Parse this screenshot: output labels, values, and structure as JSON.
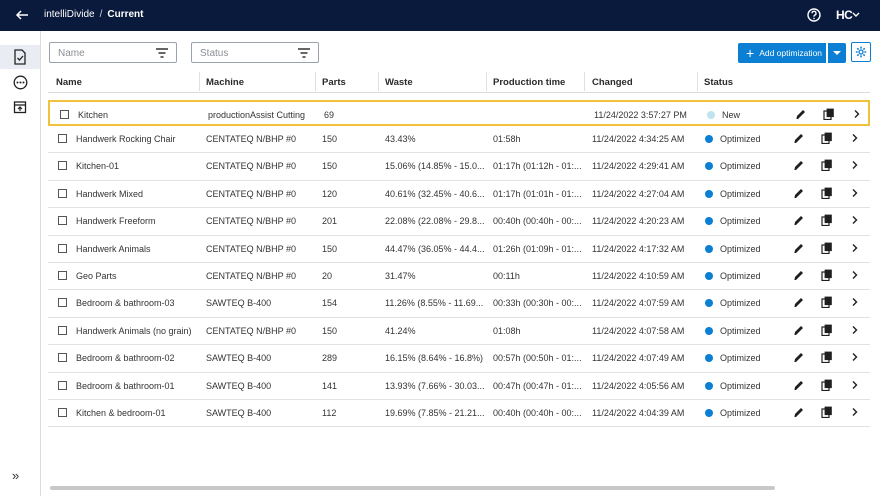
{
  "header": {
    "app": "intelliDivide",
    "separator": "/",
    "current": "Current",
    "logo_text": "HC"
  },
  "sidebar": {
    "items": [
      {
        "icon": "document-check-icon",
        "active": true
      },
      {
        "icon": "more-circle-icon",
        "active": false
      },
      {
        "icon": "archive-icon",
        "active": false
      }
    ],
    "expand_label": "»"
  },
  "filters": {
    "name_placeholder": "Name",
    "status_placeholder": "Status"
  },
  "toolbar": {
    "add_label": "Add optimization",
    "add_plus": "+"
  },
  "colors": {
    "topbar": "#0a1a3c",
    "accent": "#0a7fd4",
    "highlight": "#f0c23c",
    "new_status": "#bfe4f0"
  },
  "table": {
    "headers": {
      "name": "Name",
      "machine": "Machine",
      "parts": "Parts",
      "waste": "Waste",
      "time": "Production time",
      "changed": "Changed",
      "status": "Status"
    },
    "rows": [
      {
        "name": "Kitchen",
        "machine": "productionAssist Cutting",
        "parts": "69",
        "waste": "",
        "time": "",
        "changed": "11/24/2022 3:57:27 PM",
        "status": "New",
        "selected": true
      },
      {
        "name": "Handwerk Rocking Chair",
        "machine": "CENTATEQ N/BHP #0",
        "parts": "150",
        "waste": "43.43%",
        "time": "01:58h",
        "changed": "11/24/2022 4:34:25 AM",
        "status": "Optimized"
      },
      {
        "name": "Kitchen-01",
        "machine": "CENTATEQ N/BHP #0",
        "parts": "150",
        "waste": "15.06% (14.85% - 15.0...",
        "time": "01:17h (01:12h - 01:...",
        "changed": "11/24/2022 4:29:41 AM",
        "status": "Optimized"
      },
      {
        "name": "Handwerk Mixed",
        "machine": "CENTATEQ N/BHP #0",
        "parts": "120",
        "waste": "40.61% (32.45% - 40.6...",
        "time": "01:17h (01:01h - 01:...",
        "changed": "11/24/2022 4:27:04 AM",
        "status": "Optimized"
      },
      {
        "name": "Handwerk Freeform",
        "machine": "CENTATEQ N/BHP #0",
        "parts": "201",
        "waste": "22.08% (22.08% - 29.8...",
        "time": "00:40h (00:40h - 00:...",
        "changed": "11/24/2022 4:20:23 AM",
        "status": "Optimized"
      },
      {
        "name": "Handwerk Animals",
        "machine": "CENTATEQ N/BHP #0",
        "parts": "150",
        "waste": "44.47% (36.05% - 44.4...",
        "time": "01:26h (01:09h - 01:...",
        "changed": "11/24/2022 4:17:32 AM",
        "status": "Optimized"
      },
      {
        "name": "Geo Parts",
        "machine": "CENTATEQ N/BHP #0",
        "parts": "20",
        "waste": "31.47%",
        "time": "00:11h",
        "changed": "11/24/2022 4:10:59 AM",
        "status": "Optimized"
      },
      {
        "name": "Bedroom & bathroom-03",
        "machine": "SAWTEQ B-400",
        "parts": "154",
        "waste": "11.26% (8.55% - 11.69...",
        "time": "00:33h (00:30h - 00:...",
        "changed": "11/24/2022 4:07:59 AM",
        "status": "Optimized"
      },
      {
        "name": "Handwerk Animals (no grain)",
        "machine": "CENTATEQ N/BHP #0",
        "parts": "150",
        "waste": "41.24%",
        "time": "01:08h",
        "changed": "11/24/2022 4:07:58 AM",
        "status": "Optimized"
      },
      {
        "name": "Bedroom & bathroom-02",
        "machine": "SAWTEQ B-400",
        "parts": "289",
        "waste": "16.15% (8.64% - 16.8%)",
        "time": "00:57h (00:50h - 01:...",
        "changed": "11/24/2022 4:07:49 AM",
        "status": "Optimized"
      },
      {
        "name": "Bedroom & bathroom-01",
        "machine": "SAWTEQ B-400",
        "parts": "141",
        "waste": "13.93% (7.66% - 30.03...",
        "time": "00:47h (00:47h - 01:...",
        "changed": "11/24/2022 4:05:56 AM",
        "status": "Optimized"
      },
      {
        "name": "Kitchen & bedroom-01",
        "machine": "SAWTEQ B-400",
        "parts": "112",
        "waste": "19.69% (7.85% - 21.21...",
        "time": "00:40h (00:40h - 00:...",
        "changed": "11/24/2022 4:04:39 AM",
        "status": "Optimized"
      }
    ]
  }
}
